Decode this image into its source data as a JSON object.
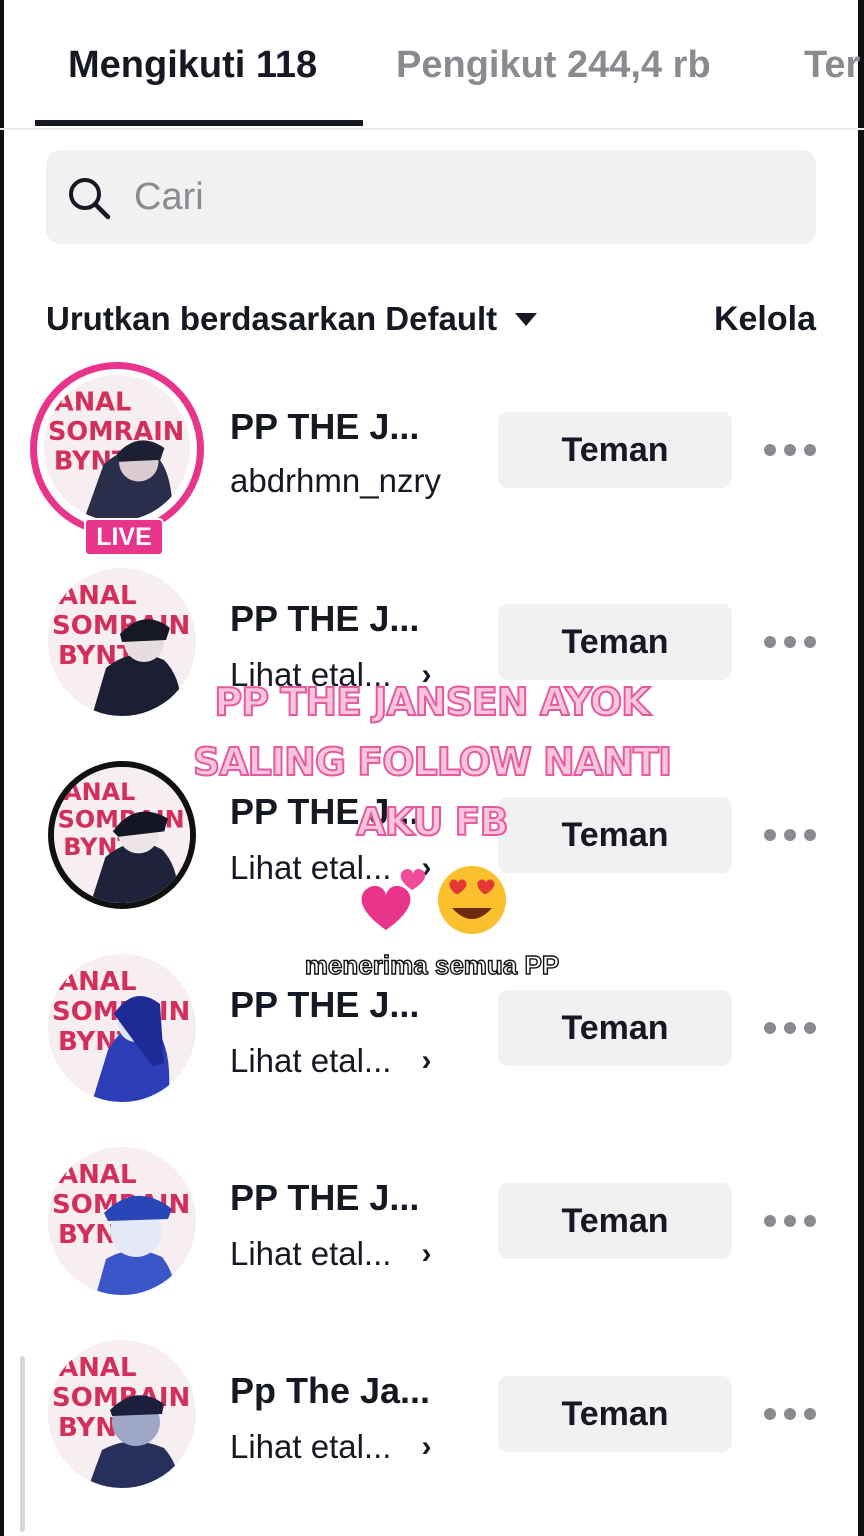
{
  "tabs": [
    {
      "label": "Mengikuti 118",
      "active": true
    },
    {
      "label": "Pengikut 244,4 rb",
      "active": false
    },
    {
      "label": "Ter",
      "active": false
    }
  ],
  "search": {
    "placeholder": "Cari"
  },
  "sort": {
    "label": "Urutkan berdasarkan Default"
  },
  "manage_label": "Kelola",
  "users": [
    {
      "name": "PP THE J...",
      "subtitle": "abdrhmn_nzry",
      "live": true,
      "live_label": "LIVE",
      "button": "Teman"
    },
    {
      "name": "PP THE J...",
      "subtitle": "Lihat etal...",
      "live": false,
      "button": "Teman"
    },
    {
      "name": "PP THE J...",
      "subtitle": "Lihat etal...",
      "live": false,
      "button": "Teman"
    },
    {
      "name": "PP THE J...",
      "subtitle": "Lihat etal...",
      "live": false,
      "button": "Teman"
    },
    {
      "name": "PP THE J...",
      "subtitle": "Lihat etal...",
      "live": false,
      "button": "Teman"
    },
    {
      "name": "Pp The Ja...",
      "subtitle": "Lihat etal...",
      "live": false,
      "button": "Teman"
    }
  ],
  "overlay": {
    "line1": "PP THE JANSEN AYOK",
    "line2": "SALING FOLLOW NANTI",
    "line3": "AKU FB",
    "emojis": "💕 😍",
    "small": "menerima semua PP"
  },
  "colors": {
    "live": "#e8348b",
    "caption": "#f9c5dd",
    "button_bg": "#f1f1f2",
    "muted": "#8a8b91"
  }
}
